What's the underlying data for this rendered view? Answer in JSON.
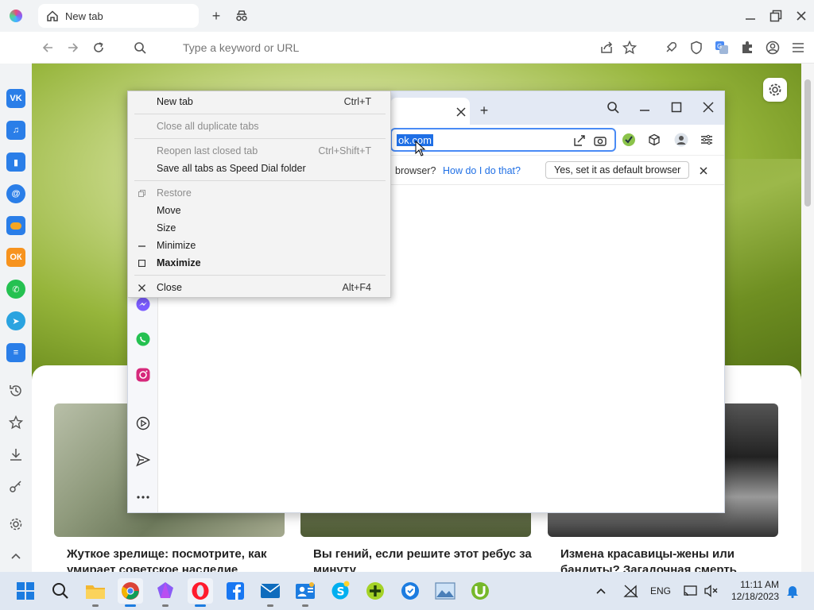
{
  "browser": {
    "tab_title": "New tab",
    "address_placeholder": "Type a keyword or URL"
  },
  "inner_window": {
    "url_selected": "ok.com",
    "banner_text": "browser?",
    "banner_link": "How do I do that?",
    "banner_button": "Yes, set it as default browser"
  },
  "context_menu": {
    "items": [
      {
        "label": "New tab",
        "shortcut": "Ctrl+T",
        "disabled": false
      },
      {
        "label": "Close all duplicate tabs",
        "shortcut": "",
        "disabled": true
      },
      {
        "label": "Reopen last closed tab",
        "shortcut": "Ctrl+Shift+T",
        "disabled": true
      },
      {
        "label": "Save all tabs as Speed Dial folder",
        "shortcut": "",
        "disabled": false
      },
      {
        "label": "Restore",
        "shortcut": "",
        "disabled": true
      },
      {
        "label": "Move",
        "shortcut": "",
        "disabled": false
      },
      {
        "label": "Size",
        "shortcut": "",
        "disabled": false
      },
      {
        "label": "Minimize",
        "shortcut": "",
        "disabled": false
      },
      {
        "label": "Maximize",
        "shortcut": "",
        "disabled": false
      },
      {
        "label": "Close",
        "shortcut": "Alt+F4",
        "disabled": false
      }
    ]
  },
  "feed": {
    "cards": [
      {
        "title": "Жуткое зрелище: посмотрите, как умирает советское наследие"
      },
      {
        "title": "Вы гений, если решите этот ребус за минуту"
      },
      {
        "title": "Измена красавицы-жены или бандиты? Загадочная смерть"
      }
    ]
  },
  "taskbar": {
    "language": "ENG",
    "time": "11:11 AM",
    "date": "12/18/2023"
  },
  "colors": {
    "accent": "#1f6fe5",
    "chrome_bg": "#f1f3f5",
    "taskbar_bg": "#dfe7f2"
  }
}
